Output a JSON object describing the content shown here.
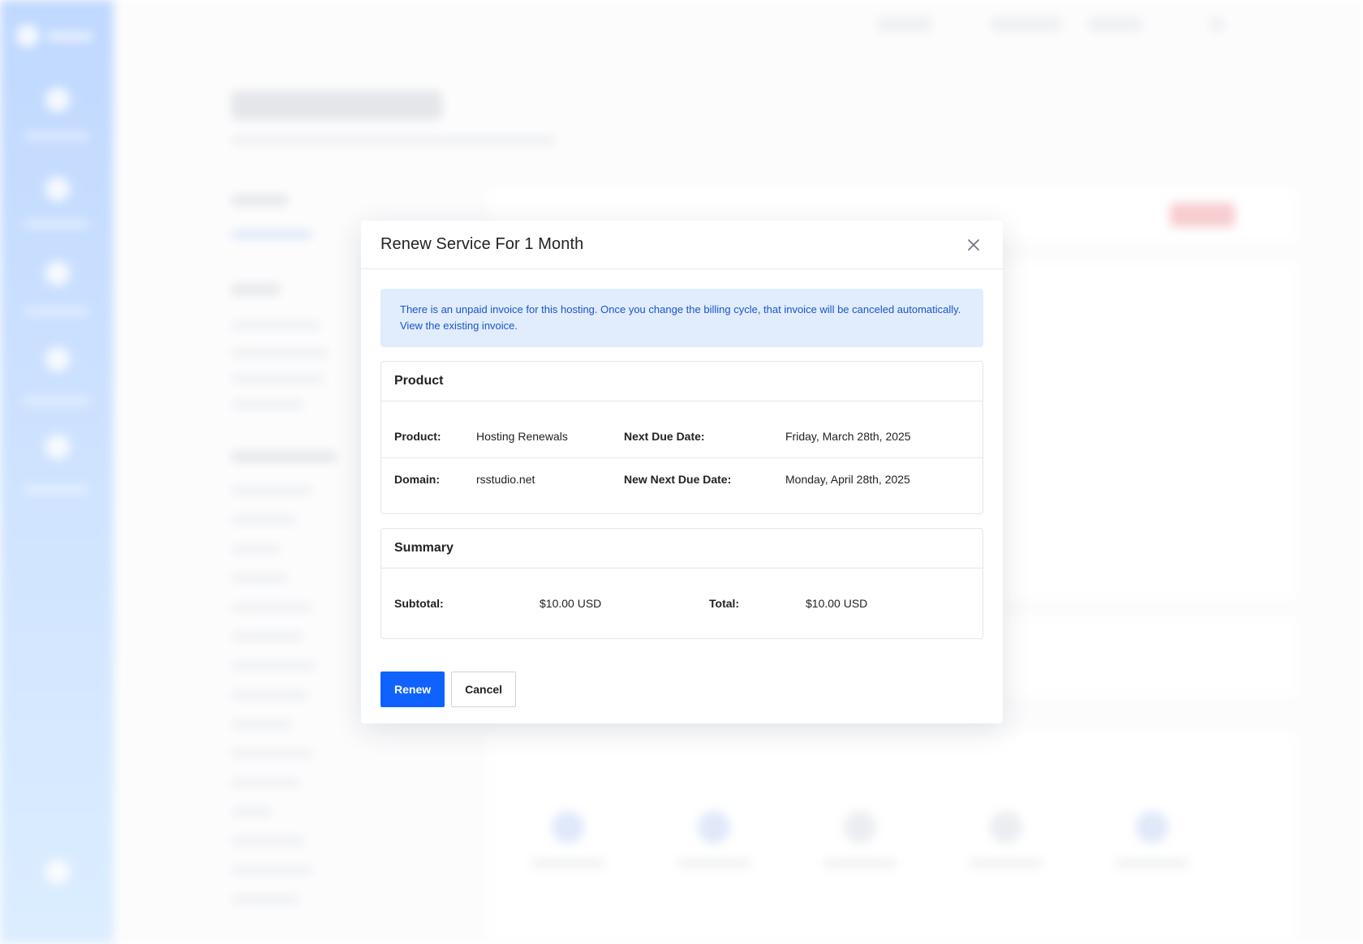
{
  "modal": {
    "title": "Renew Service For 1 Month",
    "close_icon": "close-icon",
    "alert": {
      "line1": "There is an unpaid invoice for this hosting. Once you change the billing cycle, that invoice will be canceled automatically.",
      "link": "View the existing invoice."
    },
    "product_panel": {
      "heading": "Product",
      "rows": [
        {
          "label": "Product:",
          "value": "Hosting Renewals",
          "label2": "Next Due Date:",
          "value2": "Friday, March 28th, 2025"
        },
        {
          "label": "Domain:",
          "value": "rsstudio.net",
          "label2": "New Next Due Date:",
          "value2": "Monday, April 28th, 2025"
        }
      ]
    },
    "summary_panel": {
      "heading": "Summary",
      "subtotal_label": "Subtotal:",
      "subtotal_value": "$10.00 USD",
      "total_label": "Total:",
      "total_value": "$10.00 USD"
    },
    "buttons": {
      "renew": "Renew",
      "cancel": "Cancel"
    }
  },
  "colors": {
    "primary": "#0f62fe",
    "alert_bg": "#e1ecfd",
    "alert_text": "#1a56c9",
    "sidebar_gradient_top": "#9fc4ff",
    "sidebar_gradient_bottom": "#c9e4ff"
  }
}
